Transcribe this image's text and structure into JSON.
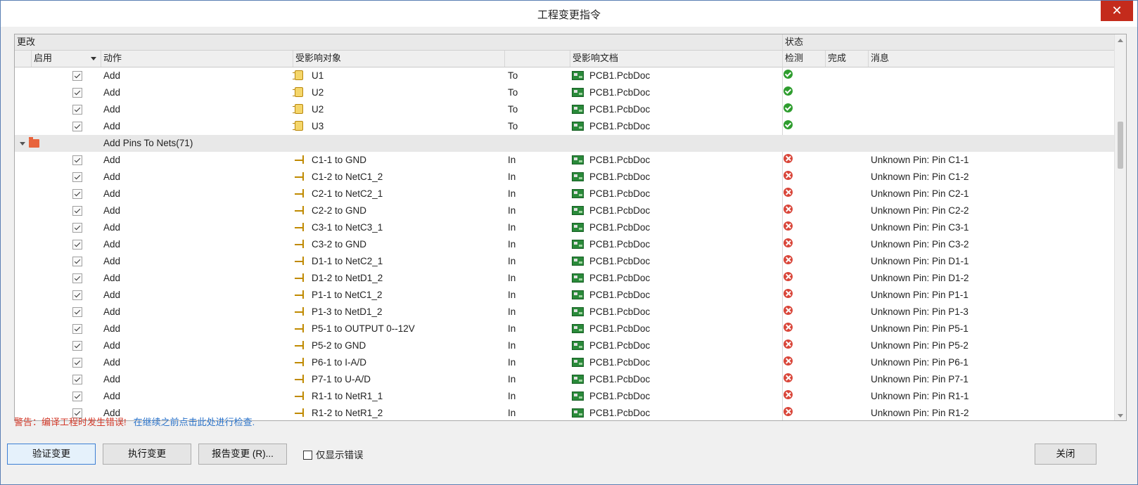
{
  "window": {
    "title": "工程变更指令",
    "close_glyph": "✕"
  },
  "header": {
    "group_change": "更改",
    "group_status": "状态",
    "col_enable": "启用",
    "col_action": "动作",
    "col_object": "受影响对象",
    "col_document": "受影响文档",
    "col_check": "检测",
    "col_done": "完成",
    "col_message": "消息"
  },
  "rows": [
    {
      "kind": "item",
      "icon": "chip-icon",
      "action": "Add",
      "object": "U1",
      "dir": "To",
      "doc": "PCB1.PcbDoc",
      "status": "ok",
      "message": ""
    },
    {
      "kind": "item",
      "icon": "chip-icon",
      "action": "Add",
      "object": "U2",
      "dir": "To",
      "doc": "PCB1.PcbDoc",
      "status": "ok",
      "message": ""
    },
    {
      "kind": "item",
      "icon": "chip-icon",
      "action": "Add",
      "object": "U2",
      "dir": "To",
      "doc": "PCB1.PcbDoc",
      "status": "ok",
      "message": ""
    },
    {
      "kind": "item",
      "icon": "chip-icon",
      "action": "Add",
      "object": "U3",
      "dir": "To",
      "doc": "PCB1.PcbDoc",
      "status": "ok",
      "message": ""
    },
    {
      "kind": "group",
      "label": "Add Pins To Nets(71)"
    },
    {
      "kind": "item",
      "icon": "pin-icon",
      "action": "Add",
      "object": "C1-1 to GND",
      "dir": "In",
      "doc": "PCB1.PcbDoc",
      "status": "error",
      "message": "Unknown Pin: Pin C1-1"
    },
    {
      "kind": "item",
      "icon": "pin-icon",
      "action": "Add",
      "object": "C1-2 to NetC1_2",
      "dir": "In",
      "doc": "PCB1.PcbDoc",
      "status": "error",
      "message": "Unknown Pin: Pin C1-2"
    },
    {
      "kind": "item",
      "icon": "pin-icon",
      "action": "Add",
      "object": "C2-1 to NetC2_1",
      "dir": "In",
      "doc": "PCB1.PcbDoc",
      "status": "error",
      "message": "Unknown Pin: Pin C2-1"
    },
    {
      "kind": "item",
      "icon": "pin-icon",
      "action": "Add",
      "object": "C2-2 to GND",
      "dir": "In",
      "doc": "PCB1.PcbDoc",
      "status": "error",
      "message": "Unknown Pin: Pin C2-2"
    },
    {
      "kind": "item",
      "icon": "pin-icon",
      "action": "Add",
      "object": "C3-1 to NetC3_1",
      "dir": "In",
      "doc": "PCB1.PcbDoc",
      "status": "error",
      "message": "Unknown Pin: Pin C3-1"
    },
    {
      "kind": "item",
      "icon": "pin-icon",
      "action": "Add",
      "object": "C3-2 to GND",
      "dir": "In",
      "doc": "PCB1.PcbDoc",
      "status": "error",
      "message": "Unknown Pin: Pin C3-2"
    },
    {
      "kind": "item",
      "icon": "pin-icon",
      "action": "Add",
      "object": "D1-1 to NetC2_1",
      "dir": "In",
      "doc": "PCB1.PcbDoc",
      "status": "error",
      "message": "Unknown Pin: Pin D1-1"
    },
    {
      "kind": "item",
      "icon": "pin-icon",
      "action": "Add",
      "object": "D1-2 to NetD1_2",
      "dir": "In",
      "doc": "PCB1.PcbDoc",
      "status": "error",
      "message": "Unknown Pin: Pin D1-2"
    },
    {
      "kind": "item",
      "icon": "pin-icon",
      "action": "Add",
      "object": "P1-1 to NetC1_2",
      "dir": "In",
      "doc": "PCB1.PcbDoc",
      "status": "error",
      "message": "Unknown Pin: Pin P1-1"
    },
    {
      "kind": "item",
      "icon": "pin-icon",
      "action": "Add",
      "object": "P1-3 to NetD1_2",
      "dir": "In",
      "doc": "PCB1.PcbDoc",
      "status": "error",
      "message": "Unknown Pin: Pin P1-3"
    },
    {
      "kind": "item",
      "icon": "pin-icon",
      "action": "Add",
      "object": "P5-1 to OUTPUT 0--12V",
      "dir": "In",
      "doc": "PCB1.PcbDoc",
      "status": "error",
      "message": "Unknown Pin: Pin P5-1"
    },
    {
      "kind": "item",
      "icon": "pin-icon",
      "action": "Add",
      "object": "P5-2 to GND",
      "dir": "In",
      "doc": "PCB1.PcbDoc",
      "status": "error",
      "message": "Unknown Pin: Pin P5-2"
    },
    {
      "kind": "item",
      "icon": "pin-icon",
      "action": "Add",
      "object": "P6-1 to I-A/D",
      "dir": "In",
      "doc": "PCB1.PcbDoc",
      "status": "error",
      "message": "Unknown Pin: Pin P6-1"
    },
    {
      "kind": "item",
      "icon": "pin-icon",
      "action": "Add",
      "object": "P7-1 to U-A/D",
      "dir": "In",
      "doc": "PCB1.PcbDoc",
      "status": "error",
      "message": "Unknown Pin: Pin P7-1"
    },
    {
      "kind": "item",
      "icon": "pin-icon",
      "action": "Add",
      "object": "R1-1 to NetR1_1",
      "dir": "In",
      "doc": "PCB1.PcbDoc",
      "status": "error",
      "message": "Unknown Pin: Pin R1-1"
    },
    {
      "kind": "item",
      "icon": "pin-icon",
      "action": "Add",
      "object": "R1-2 to NetR1_2",
      "dir": "In",
      "doc": "PCB1.PcbDoc",
      "status": "error",
      "message": "Unknown Pin: Pin R1-2"
    }
  ],
  "warning": {
    "text": "警告：编译工程时发生错误!",
    "link": "在继续之前点击此处进行检查."
  },
  "buttons": {
    "validate": "验证变更",
    "execute": "执行变更",
    "report": "报告变更 (R)...",
    "only_errors": "仅显示错误",
    "close": "关闭"
  },
  "colors": {
    "error_red": "#d23a2a",
    "link_blue": "#2b73c9",
    "ok_green": "#2f9d2f"
  }
}
